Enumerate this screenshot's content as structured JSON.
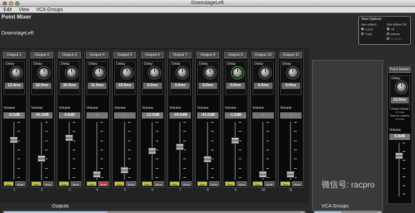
{
  "window": {
    "title": "DownstageLeft"
  },
  "menu": [
    "Edit",
    "View",
    "VCA Groups"
  ],
  "app": {
    "name": "Point Mixer",
    "location": "DownstageLeft"
  },
  "view_options": {
    "title": "View Options",
    "col1": {
      "head": "See values:",
      "options": [
        "Local",
        "Total"
      ],
      "selected": 0
    },
    "col2": {
      "head": "See values for:",
      "options": [
        "All",
        "Master",
        "Custom"
      ],
      "selected": 0
    }
  },
  "labels": {
    "delay": "Delay",
    "volume": "Volume",
    "solo": "Solo",
    "mute": "Mute"
  },
  "channels": [
    {
      "name": "Output 1",
      "num": "1",
      "delay": "13.0ms",
      "volume": "-5.5dB",
      "fader": 0.72,
      "muted": false
    },
    {
      "name": "Output 2",
      "num": "2",
      "delay": "18.0ms",
      "volume": "-41.0dB",
      "fader": 0.35,
      "muted": false
    },
    {
      "name": "Output 3",
      "num": "3",
      "delay": "30.0ms",
      "volume": "4.0dB",
      "fader": 0.76,
      "muted": false
    },
    {
      "name": "Output 4",
      "num": "4",
      "delay": "11.0ms",
      "volume": "-",
      "fader": 0.04,
      "muted": true
    },
    {
      "name": "Output 5",
      "num": "5",
      "delay": "19.5ms",
      "volume": "-",
      "fader": 0.12,
      "muted": false
    },
    {
      "name": "Output 6",
      "num": "6",
      "delay": "9.0ms",
      "volume": "-13.0dB",
      "fader": 0.5,
      "muted": false
    },
    {
      "name": "Output 7",
      "num": "7",
      "delay": "3.0ms",
      "volume": "-24.5dB",
      "fader": 0.58,
      "muted": false
    },
    {
      "name": "Output 8",
      "num": "8",
      "delay": "0.0ms",
      "volume": "-41.0dB",
      "fader": 0.34,
      "muted": false
    },
    {
      "name": "Output 9",
      "num": "9",
      "delay": "0.0ms",
      "volume": "-1.5dB",
      "fader": 0.7,
      "muted": false
    },
    {
      "name": "Output 10",
      "num": "10",
      "delay": "0.0ms",
      "volume": "-",
      "fader": 0.04,
      "muted": false
    },
    {
      "name": "Output 11",
      "num": "11",
      "delay": "0.0ms",
      "volume": "-",
      "fader": 0.04,
      "muted": false
    }
  ],
  "master": {
    "name": "Point Master",
    "delay": "13.0ms",
    "info": [
      "Phase Global",
      "0.0 ms",
      "System Latency",
      "0.0 ms"
    ],
    "volume": "0.0dB",
    "fader": 0.8
  },
  "footer": {
    "outputs": "Outputs",
    "vca_groups": "VCA Groups"
  },
  "watermark": "微信号: racpro"
}
